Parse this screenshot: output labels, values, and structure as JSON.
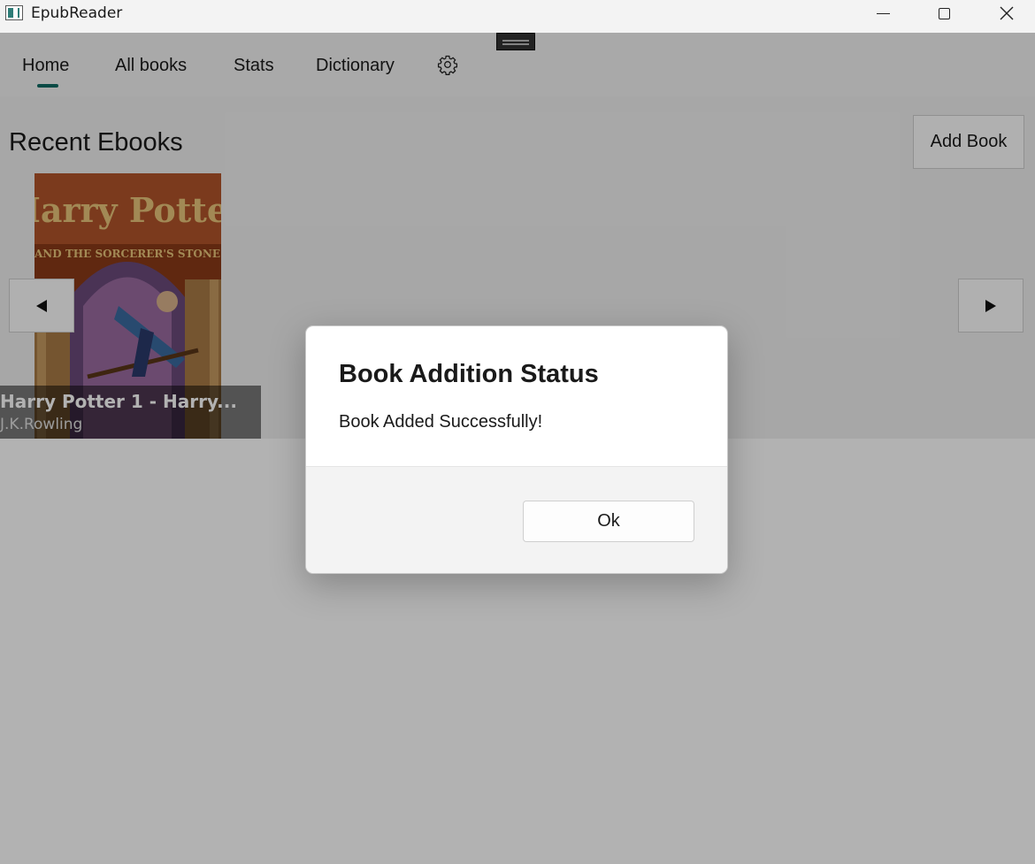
{
  "window": {
    "title": "EpubReader",
    "controls": [
      "minimize-icon",
      "maximize-icon",
      "close-icon"
    ]
  },
  "nav": {
    "tabs": [
      {
        "label": "Home",
        "selected": true
      },
      {
        "label": "All books",
        "selected": false
      },
      {
        "label": "Stats",
        "selected": false
      },
      {
        "label": "Dictionary",
        "selected": false
      }
    ],
    "settings_icon": "gear-icon",
    "accent_color": "#0e6b63"
  },
  "home": {
    "section_title": "Recent Ebooks",
    "add_book_label": "Add Book",
    "prev_icon": "triangle-left-icon",
    "next_icon": "triangle-right-icon",
    "books": [
      {
        "title": "Harry Potter 1 - Harry...",
        "author": "J.K.Rowling",
        "cover_title": "Harry Potter",
        "cover_subtitle": "AND THE SORCERER'S STONE"
      }
    ]
  },
  "dialog": {
    "title": "Book Addition Status",
    "message": "Book Added Successfully!",
    "ok_label": "Ok"
  }
}
